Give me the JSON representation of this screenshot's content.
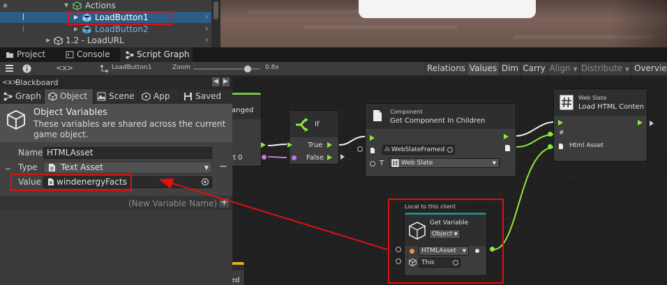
{
  "hierarchy": {
    "actions_label": "Actions",
    "selected_item": "LoadButton1",
    "item_2": "LoadButton2",
    "item_3": "1.2 - LoadURL"
  },
  "tabs": [
    {
      "label": "Project",
      "icon": "folder-icon"
    },
    {
      "label": "Console",
      "icon": "console-icon"
    },
    {
      "label": "Script Graph",
      "icon": "graph-icon"
    }
  ],
  "toolbar": {
    "breadcrumb_symbol": "<x>",
    "object_label": "LoadButton1",
    "zoom_label": "Zoom",
    "zoom_value": "0.8x",
    "zoom_fraction": 0.82,
    "buttons": [
      "Relations",
      "Values",
      "Dim",
      "Carry",
      "Align",
      "Distribute",
      "Overview"
    ]
  },
  "blackboard": {
    "title": "Blackboard",
    "tabs": [
      "Graph",
      "Object",
      "Scene",
      "App",
      "Saved"
    ],
    "section_title": "Object Variables",
    "section_desc_1": "These variables are shared across the current",
    "section_desc_2": "game object.",
    "name_label": "Name",
    "name_value": "HTMLAsset",
    "type_label": "Type",
    "type_value": "Text Asset",
    "value_label": "Value",
    "value_value": "windenergyFacts",
    "new_variable_placeholder": "(New Variable Name)",
    "add_symbol": "+",
    "remove_symbol": "−"
  },
  "graph": {
    "partial_node_title": "anged",
    "partial_node_port": "t 0",
    "partial_bottom_text": "ed",
    "if_node": {
      "title": "If",
      "true_label": "True",
      "false_label": "False"
    },
    "component_node": {
      "category": "Component",
      "title": "Get Component In Children",
      "input_value": "WebSlateFramed",
      "type_prefix": "T",
      "type_value": "Web Slate"
    },
    "webslate_node": {
      "category": "Web Slate",
      "title": "Load HTML Conten",
      "hash_label": "#",
      "html_asset_label": "Html Asset"
    },
    "getvar_node": {
      "scope_label": "Local to this client",
      "title": "Get Variable",
      "kind_value": "Object",
      "name_value": "HTMLAsset",
      "target_value": "This"
    }
  },
  "colors": {
    "highlight_red": "#e01010",
    "flow_green": "#8aea3c",
    "selection_blue": "#2c5d87"
  }
}
